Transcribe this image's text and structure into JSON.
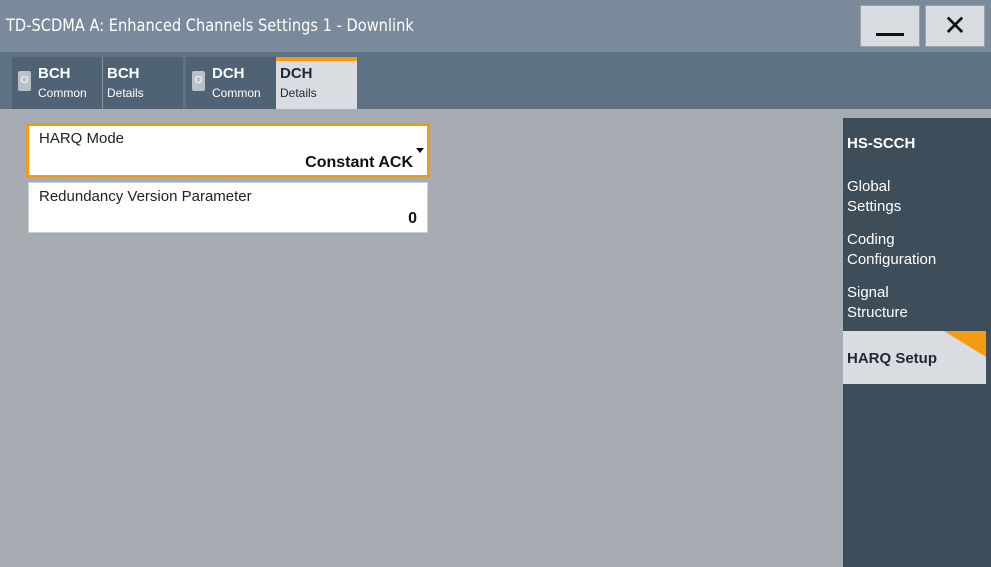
{
  "window": {
    "title": "TD-SCDMA A: Enhanced Channels Settings 1 - Downlink",
    "minimize_icon": "minimize-icon",
    "close_icon": "close-icon"
  },
  "tabs": [
    {
      "toggle": "O",
      "cells": [
        {
          "t1": "BCH",
          "t2": "Common"
        },
        {
          "t1": "BCH",
          "t2": "Details"
        }
      ],
      "active": false
    },
    {
      "toggle": "O",
      "cells": [
        {
          "t1": "DCH",
          "t2": "Common"
        },
        {
          "t1": "DCH",
          "t2": "Details"
        }
      ],
      "active": true
    }
  ],
  "fields": {
    "harq_mode": {
      "label": "HARQ Mode",
      "value": "Constant ACK"
    },
    "redundancy_version": {
      "label": "Redundancy Version Parameter",
      "value": "0"
    }
  },
  "nav": [
    {
      "label": [
        "HS-SCCH"
      ],
      "active": false
    },
    {
      "label": [
        "Global",
        "Settings"
      ],
      "active": false
    },
    {
      "label": [
        "Coding",
        "Configuration"
      ],
      "active": false
    },
    {
      "label": [
        "Signal",
        "Structure"
      ],
      "active": false
    },
    {
      "label": [
        "HARQ Setup"
      ],
      "active": true
    }
  ],
  "colors": {
    "accent": "#f39c12",
    "titlebar": "#7b8a9b",
    "panel_dark": "#3d4d5a",
    "background": "#a6acb1"
  }
}
